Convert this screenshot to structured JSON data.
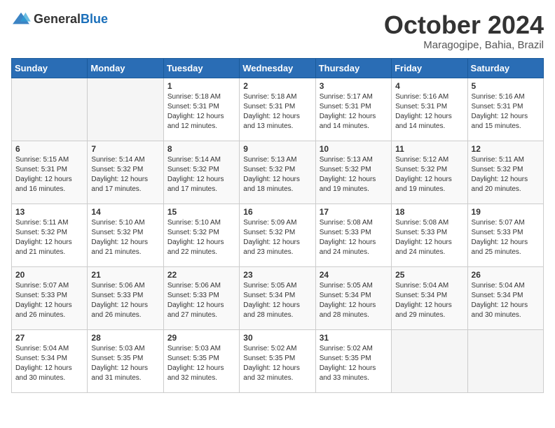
{
  "header": {
    "logo_general": "General",
    "logo_blue": "Blue",
    "month_title": "October 2024",
    "location": "Maragogipe, Bahia, Brazil"
  },
  "weekdays": [
    "Sunday",
    "Monday",
    "Tuesday",
    "Wednesday",
    "Thursday",
    "Friday",
    "Saturday"
  ],
  "weeks": [
    [
      {
        "day": "",
        "info": ""
      },
      {
        "day": "",
        "info": ""
      },
      {
        "day": "1",
        "info": "Sunrise: 5:18 AM\nSunset: 5:31 PM\nDaylight: 12 hours and 12 minutes."
      },
      {
        "day": "2",
        "info": "Sunrise: 5:18 AM\nSunset: 5:31 PM\nDaylight: 12 hours and 13 minutes."
      },
      {
        "day": "3",
        "info": "Sunrise: 5:17 AM\nSunset: 5:31 PM\nDaylight: 12 hours and 14 minutes."
      },
      {
        "day": "4",
        "info": "Sunrise: 5:16 AM\nSunset: 5:31 PM\nDaylight: 12 hours and 14 minutes."
      },
      {
        "day": "5",
        "info": "Sunrise: 5:16 AM\nSunset: 5:31 PM\nDaylight: 12 hours and 15 minutes."
      }
    ],
    [
      {
        "day": "6",
        "info": "Sunrise: 5:15 AM\nSunset: 5:31 PM\nDaylight: 12 hours and 16 minutes."
      },
      {
        "day": "7",
        "info": "Sunrise: 5:14 AM\nSunset: 5:32 PM\nDaylight: 12 hours and 17 minutes."
      },
      {
        "day": "8",
        "info": "Sunrise: 5:14 AM\nSunset: 5:32 PM\nDaylight: 12 hours and 17 minutes."
      },
      {
        "day": "9",
        "info": "Sunrise: 5:13 AM\nSunset: 5:32 PM\nDaylight: 12 hours and 18 minutes."
      },
      {
        "day": "10",
        "info": "Sunrise: 5:13 AM\nSunset: 5:32 PM\nDaylight: 12 hours and 19 minutes."
      },
      {
        "day": "11",
        "info": "Sunrise: 5:12 AM\nSunset: 5:32 PM\nDaylight: 12 hours and 19 minutes."
      },
      {
        "day": "12",
        "info": "Sunrise: 5:11 AM\nSunset: 5:32 PM\nDaylight: 12 hours and 20 minutes."
      }
    ],
    [
      {
        "day": "13",
        "info": "Sunrise: 5:11 AM\nSunset: 5:32 PM\nDaylight: 12 hours and 21 minutes."
      },
      {
        "day": "14",
        "info": "Sunrise: 5:10 AM\nSunset: 5:32 PM\nDaylight: 12 hours and 21 minutes."
      },
      {
        "day": "15",
        "info": "Sunrise: 5:10 AM\nSunset: 5:32 PM\nDaylight: 12 hours and 22 minutes."
      },
      {
        "day": "16",
        "info": "Sunrise: 5:09 AM\nSunset: 5:32 PM\nDaylight: 12 hours and 23 minutes."
      },
      {
        "day": "17",
        "info": "Sunrise: 5:08 AM\nSunset: 5:33 PM\nDaylight: 12 hours and 24 minutes."
      },
      {
        "day": "18",
        "info": "Sunrise: 5:08 AM\nSunset: 5:33 PM\nDaylight: 12 hours and 24 minutes."
      },
      {
        "day": "19",
        "info": "Sunrise: 5:07 AM\nSunset: 5:33 PM\nDaylight: 12 hours and 25 minutes."
      }
    ],
    [
      {
        "day": "20",
        "info": "Sunrise: 5:07 AM\nSunset: 5:33 PM\nDaylight: 12 hours and 26 minutes."
      },
      {
        "day": "21",
        "info": "Sunrise: 5:06 AM\nSunset: 5:33 PM\nDaylight: 12 hours and 26 minutes."
      },
      {
        "day": "22",
        "info": "Sunrise: 5:06 AM\nSunset: 5:33 PM\nDaylight: 12 hours and 27 minutes."
      },
      {
        "day": "23",
        "info": "Sunrise: 5:05 AM\nSunset: 5:34 PM\nDaylight: 12 hours and 28 minutes."
      },
      {
        "day": "24",
        "info": "Sunrise: 5:05 AM\nSunset: 5:34 PM\nDaylight: 12 hours and 28 minutes."
      },
      {
        "day": "25",
        "info": "Sunrise: 5:04 AM\nSunset: 5:34 PM\nDaylight: 12 hours and 29 minutes."
      },
      {
        "day": "26",
        "info": "Sunrise: 5:04 AM\nSunset: 5:34 PM\nDaylight: 12 hours and 30 minutes."
      }
    ],
    [
      {
        "day": "27",
        "info": "Sunrise: 5:04 AM\nSunset: 5:34 PM\nDaylight: 12 hours and 30 minutes."
      },
      {
        "day": "28",
        "info": "Sunrise: 5:03 AM\nSunset: 5:35 PM\nDaylight: 12 hours and 31 minutes."
      },
      {
        "day": "29",
        "info": "Sunrise: 5:03 AM\nSunset: 5:35 PM\nDaylight: 12 hours and 32 minutes."
      },
      {
        "day": "30",
        "info": "Sunrise: 5:02 AM\nSunset: 5:35 PM\nDaylight: 12 hours and 32 minutes."
      },
      {
        "day": "31",
        "info": "Sunrise: 5:02 AM\nSunset: 5:35 PM\nDaylight: 12 hours and 33 minutes."
      },
      {
        "day": "",
        "info": ""
      },
      {
        "day": "",
        "info": ""
      }
    ]
  ]
}
